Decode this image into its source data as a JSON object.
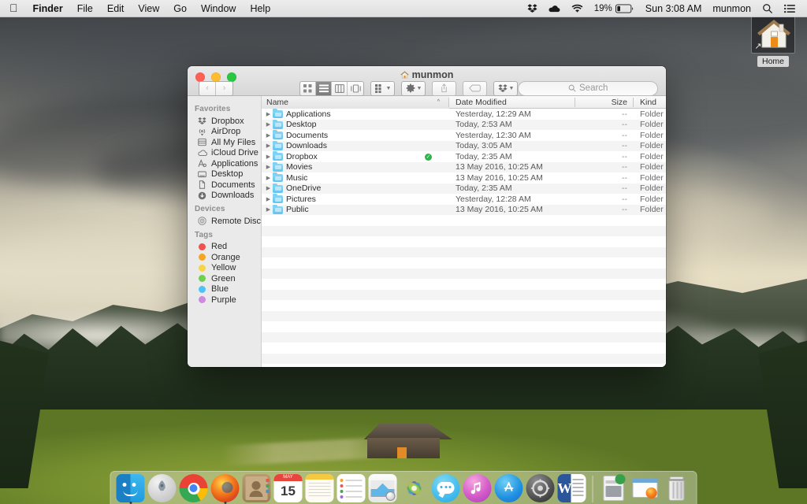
{
  "menubar": {
    "apple_icon": "apple-logo-icon",
    "items": [
      {
        "label": "Finder",
        "bold": true
      },
      {
        "label": "File",
        "bold": false
      },
      {
        "label": "Edit",
        "bold": false
      },
      {
        "label": "View",
        "bold": false
      },
      {
        "label": "Go",
        "bold": false
      },
      {
        "label": "Window",
        "bold": false
      },
      {
        "label": "Help",
        "bold": false
      }
    ],
    "status": {
      "dropbox_icon": "dropbox-icon",
      "cloud_icon": "cloud-icon",
      "wifi_icon": "wifi-icon",
      "battery_percent": "19%",
      "battery_icon": "battery-icon",
      "clock": "Sun 3:08 AM",
      "user": "munmon",
      "search_icon": "spotlight-search-icon",
      "notification_icon": "notification-center-icon"
    }
  },
  "desktop": {
    "home_icon": {
      "label": "Home",
      "icon": "house-icon",
      "alias_badge": "alias-arrow-icon"
    }
  },
  "finder": {
    "title": "munmon",
    "title_icon": "home-folder-icon",
    "traffic_lights": {
      "close": "close-button",
      "minimize": "minimize-button",
      "zoom": "zoom-button"
    },
    "toolbar": {
      "back": "‹",
      "forward": "›",
      "views": [
        {
          "name": "icon-view",
          "glyph": "∷",
          "active": false
        },
        {
          "name": "list-view",
          "glyph": "≡",
          "active": true
        },
        {
          "name": "column-view",
          "glyph": "‖",
          "active": false
        },
        {
          "name": "coverflow-view",
          "glyph": "□",
          "active": false
        }
      ],
      "arrange_label": "arrange-icon",
      "action_label": "⚙",
      "share_label": "⇧",
      "tag_label": "tag-icon",
      "dropbox_label": "dropbox-icon",
      "search_placeholder": "Search"
    },
    "sidebar": {
      "sections": [
        {
          "title": "Favorites",
          "items": [
            {
              "label": "Dropbox",
              "icon": "dropbox-icon"
            },
            {
              "label": "AirDrop",
              "icon": "airdrop-icon"
            },
            {
              "label": "All My Files",
              "icon": "all-my-files-icon"
            },
            {
              "label": "iCloud Drive",
              "icon": "icloud-icon"
            },
            {
              "label": "Applications",
              "icon": "applications-icon"
            },
            {
              "label": "Desktop",
              "icon": "desktop-icon"
            },
            {
              "label": "Documents",
              "icon": "documents-icon"
            },
            {
              "label": "Downloads",
              "icon": "downloads-icon"
            }
          ]
        },
        {
          "title": "Devices",
          "items": [
            {
              "label": "Remote Disc",
              "icon": "remote-disc-icon"
            }
          ]
        },
        {
          "title": "Tags",
          "items": [
            {
              "label": "Red",
              "icon": "tag-dot-icon",
              "color": "#ef5350"
            },
            {
              "label": "Orange",
              "icon": "tag-dot-icon",
              "color": "#f5a623"
            },
            {
              "label": "Yellow",
              "icon": "tag-dot-icon",
              "color": "#f7d547"
            },
            {
              "label": "Green",
              "icon": "tag-dot-icon",
              "color": "#6fcf4f"
            },
            {
              "label": "Blue",
              "icon": "tag-dot-icon",
              "color": "#4fc3f7"
            },
            {
              "label": "Purple",
              "icon": "tag-dot-icon",
              "color": "#cf8ae0"
            }
          ]
        }
      ]
    },
    "columns": [
      {
        "key": "name",
        "label": "Name",
        "sorted": true,
        "sort_caret": "^"
      },
      {
        "key": "date",
        "label": "Date Modified",
        "sorted": false
      },
      {
        "key": "size",
        "label": "Size",
        "sorted": false
      },
      {
        "key": "kind",
        "label": "Kind",
        "sorted": false
      }
    ],
    "rows": [
      {
        "name": "Applications",
        "date": "Yesterday, 12:29 AM",
        "size": "--",
        "kind": "Folder",
        "badge": ""
      },
      {
        "name": "Desktop",
        "date": "Today, 2:53 AM",
        "size": "--",
        "kind": "Folder",
        "badge": ""
      },
      {
        "name": "Documents",
        "date": "Yesterday, 12:30 AM",
        "size": "--",
        "kind": "Folder",
        "badge": ""
      },
      {
        "name": "Downloads",
        "date": "Today, 3:05 AM",
        "size": "--",
        "kind": "Folder",
        "badge": ""
      },
      {
        "name": "Dropbox",
        "date": "Today, 2:35 AM",
        "size": "--",
        "kind": "Folder",
        "badge": "✓"
      },
      {
        "name": "Movies",
        "date": "13 May 2016, 10:25 AM",
        "size": "--",
        "kind": "Folder",
        "badge": ""
      },
      {
        "name": "Music",
        "date": "13 May 2016, 10:25 AM",
        "size": "--",
        "kind": "Folder",
        "badge": ""
      },
      {
        "name": "OneDrive",
        "date": "Today, 2:35 AM",
        "size": "--",
        "kind": "Folder",
        "badge": ""
      },
      {
        "name": "Pictures",
        "date": "Yesterday, 12:28 AM",
        "size": "--",
        "kind": "Folder",
        "badge": ""
      },
      {
        "name": "Public",
        "date": "13 May 2016, 10:25 AM",
        "size": "--",
        "kind": "Folder",
        "badge": ""
      }
    ]
  },
  "dock": {
    "items": [
      {
        "name": "finder",
        "label": "Finder",
        "running": true
      },
      {
        "name": "launchpad",
        "label": "Launchpad",
        "running": false
      },
      {
        "name": "google-chrome",
        "label": "Google Chrome",
        "running": false
      },
      {
        "name": "firefox",
        "label": "Firefox",
        "running": true
      },
      {
        "name": "contacts",
        "label": "Contacts",
        "running": false
      },
      {
        "name": "calendar",
        "label": "Calendar",
        "running": false
      },
      {
        "name": "notes",
        "label": "Notes",
        "running": false
      },
      {
        "name": "reminders",
        "label": "Reminders",
        "running": false
      },
      {
        "name": "mail",
        "label": "Mail",
        "running": false
      },
      {
        "name": "photos",
        "label": "Photos",
        "running": false
      },
      {
        "name": "messages",
        "label": "Messages",
        "running": false
      },
      {
        "name": "itunes",
        "label": "iTunes",
        "running": false
      },
      {
        "name": "app-store",
        "label": "App Store",
        "running": false
      },
      {
        "name": "system-preferences",
        "label": "System Preferences",
        "running": false
      },
      {
        "name": "microsoft-word",
        "label": "Microsoft Word",
        "running": false
      }
    ],
    "stacks": [
      {
        "name": "downloads-stack",
        "label": "Downloads"
      },
      {
        "name": "documents-stack",
        "label": "Documents"
      },
      {
        "name": "trash",
        "label": "Trash"
      }
    ],
    "calendar_day": "15",
    "calendar_month": "MAY"
  }
}
